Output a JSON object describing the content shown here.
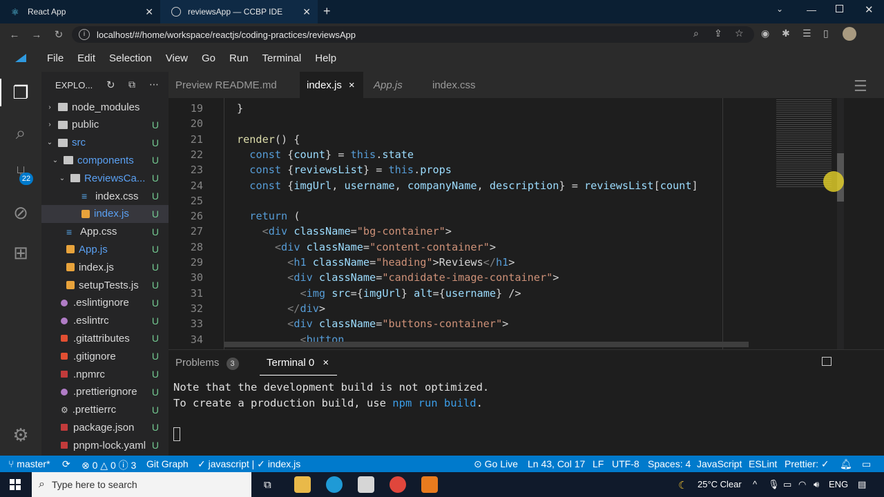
{
  "browser": {
    "tabs": [
      {
        "title": "React App",
        "active": false
      },
      {
        "title": "reviewsApp — CCBP IDE",
        "active": true
      }
    ],
    "url": "localhost/#/home/workspace/reactjs/coding-practices/reviewsApp"
  },
  "menu": [
    "File",
    "Edit",
    "Selection",
    "View",
    "Go",
    "Run",
    "Terminal",
    "Help"
  ],
  "activity": {
    "scm_badge": "22"
  },
  "explorer": {
    "title": "EXPLO...",
    "items": [
      {
        "label": "node_modules",
        "type": "folder",
        "depth": 0,
        "status": ""
      },
      {
        "label": "public",
        "type": "folder",
        "depth": 0,
        "status": "U"
      },
      {
        "label": "src",
        "type": "folder",
        "depth": 0,
        "status": "U"
      },
      {
        "label": "components",
        "type": "folder",
        "depth": 1,
        "status": "U"
      },
      {
        "label": "ReviewsCa...",
        "type": "folder",
        "depth": 2,
        "status": "U"
      },
      {
        "label": "index.css",
        "type": "css",
        "depth": 3,
        "status": "U"
      },
      {
        "label": "index.js",
        "type": "js",
        "depth": 3,
        "status": "U"
      },
      {
        "label": "App.css",
        "type": "css",
        "depth": 1,
        "status": "U"
      },
      {
        "label": "App.js",
        "type": "js",
        "depth": 1,
        "status": "U"
      },
      {
        "label": "index.js",
        "type": "js",
        "depth": 1,
        "status": "U"
      },
      {
        "label": "setupTests.js",
        "type": "js",
        "depth": 1,
        "status": "U"
      },
      {
        "label": ".eslintignore",
        "type": "dot",
        "depth": 0,
        "status": "U"
      },
      {
        "label": ".eslintrc",
        "type": "dot",
        "depth": 0,
        "status": "U"
      },
      {
        "label": ".gitattributes",
        "type": "git",
        "depth": 0,
        "status": "U"
      },
      {
        "label": ".gitignore",
        "type": "git",
        "depth": 0,
        "status": "U"
      },
      {
        "label": ".npmrc",
        "type": "npm",
        "depth": 0,
        "status": "U"
      },
      {
        "label": ".prettierignore",
        "type": "dot",
        "depth": 0,
        "status": "U"
      },
      {
        "label": ".prettierrc",
        "type": "gear",
        "depth": 0,
        "status": "U"
      },
      {
        "label": "package.json",
        "type": "npm",
        "depth": 0,
        "status": "U"
      },
      {
        "label": "pnpm-lock.yaml",
        "type": "npm",
        "depth": 0,
        "status": "U"
      }
    ]
  },
  "editor_tabs": [
    {
      "label": "Preview README.md",
      "active": false
    },
    {
      "label": "index.js",
      "active": true,
      "close": "×"
    },
    {
      "label": "App.js",
      "active": false
    },
    {
      "label": "index.css",
      "active": false
    }
  ],
  "code_lines": [
    {
      "n": "19",
      "text": "}"
    },
    {
      "n": "20",
      "text": ""
    },
    {
      "n": "21",
      "text": "render() {"
    },
    {
      "n": "22",
      "text": "  const {count} = this.state"
    },
    {
      "n": "23",
      "text": "  const {reviewsList} = this.props"
    },
    {
      "n": "24",
      "text": "  const {imgUrl, username, companyName, description} = reviewsList[count]"
    },
    {
      "n": "25",
      "text": ""
    },
    {
      "n": "26",
      "text": "  return ("
    },
    {
      "n": "27",
      "text": "    <div className=\"bg-container\">"
    },
    {
      "n": "28",
      "text": "      <div className=\"content-container\">"
    },
    {
      "n": "29",
      "text": "        <h1 className=\"heading\">Reviews</h1>"
    },
    {
      "n": "30",
      "text": "        <div className=\"candidate-image-container\">"
    },
    {
      "n": "31",
      "text": "          <img src={imgUrl} alt={username} />"
    },
    {
      "n": "32",
      "text": "        </div>"
    },
    {
      "n": "33",
      "text": "        <div className=\"buttons-container\">"
    },
    {
      "n": "34",
      "text": "          <button"
    }
  ],
  "panel": {
    "problems_label": "Problems",
    "problems_count": "3",
    "terminal_label": "Terminal 0",
    "close": "×",
    "lines": [
      "Note that the development build is not optimized.",
      "To create a production build, use "
    ],
    "highlight": "npm run build",
    "tail": "."
  },
  "statusbar": {
    "branch": "master*",
    "errors": "0",
    "warnings": "0",
    "info": "3",
    "git_graph": "Git Graph",
    "lang_check": "javascript |",
    "file": "index.js",
    "go_live": "Go Live",
    "position": "Ln 43, Col 17",
    "eol": "LF",
    "encoding": "UTF-8",
    "spaces": "Spaces: 4",
    "language": "JavaScript",
    "eslint": "ESLint",
    "prettier": "Prettier: ✓"
  },
  "taskbar": {
    "search_placeholder": "Type here to search",
    "weather": "25°C  Clear",
    "lang": "ENG"
  }
}
